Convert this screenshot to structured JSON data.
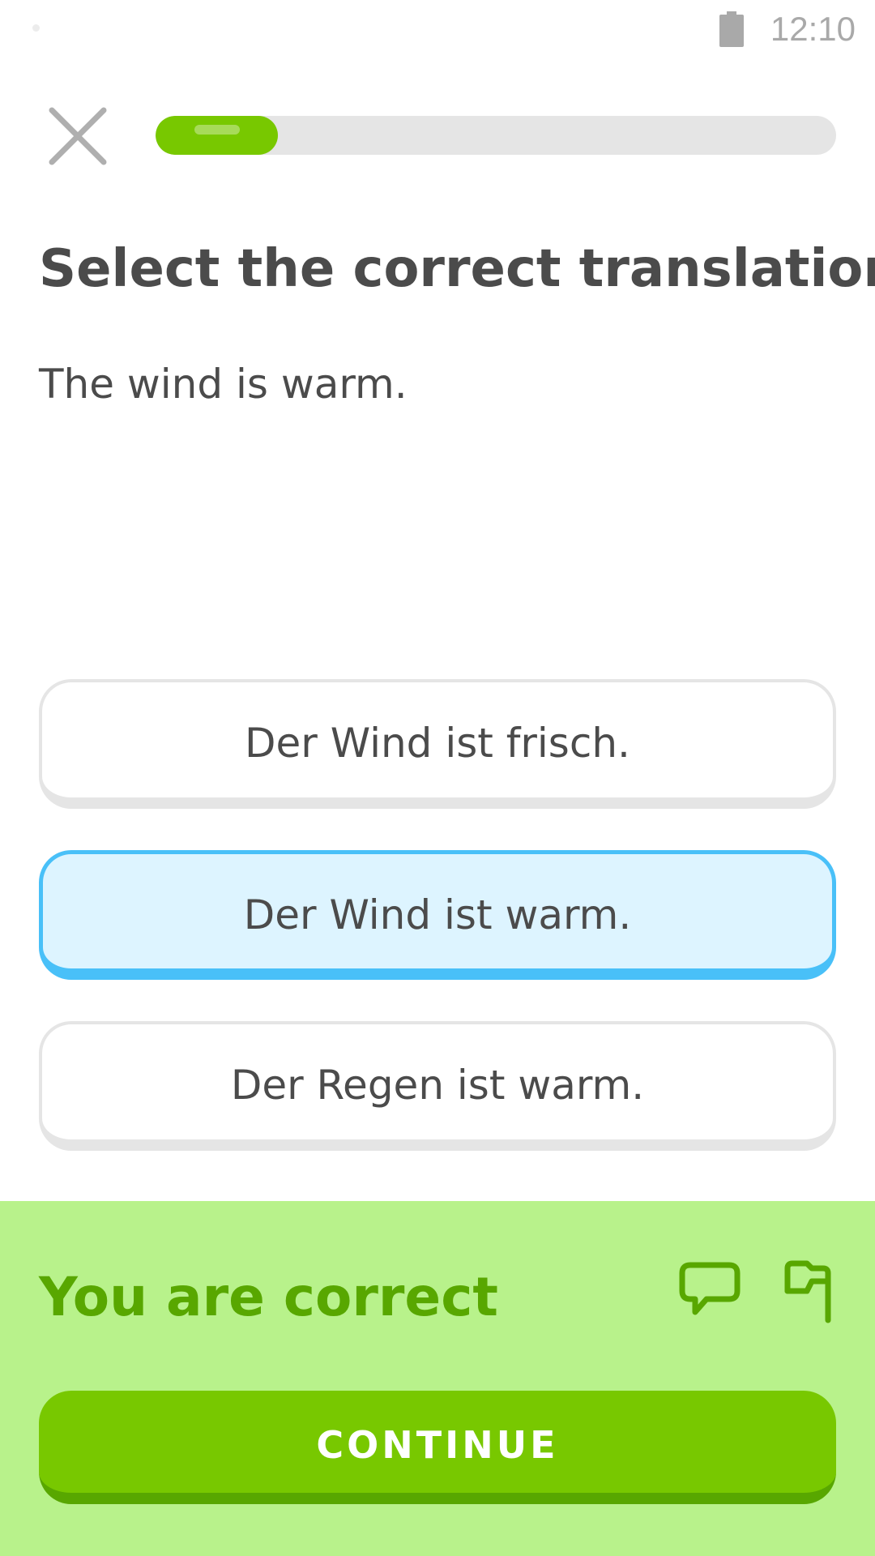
{
  "status_bar": {
    "time": "12:10"
  },
  "lesson": {
    "progress_fraction": 0.18
  },
  "instruction": "Select the correct translation",
  "prompt": "The wind is warm.",
  "choices": [
    {
      "label": "Der Wind ist frisch.",
      "selected": false
    },
    {
      "label": "Der Wind ist warm.",
      "selected": true
    },
    {
      "label": "Der Regen ist warm.",
      "selected": false
    }
  ],
  "feedback": {
    "title": "You are correct",
    "continue_label": "CONTINUE"
  },
  "colors": {
    "accent_green": "#78c800",
    "feedback_bg": "#b8f28b",
    "feedback_text": "#58a700",
    "selected_border": "#49c0f8",
    "selected_bg": "#ddf4ff"
  },
  "icons": {
    "close": "close-icon",
    "battery": "battery-icon",
    "discuss": "chat-bubble-icon",
    "report": "flag-icon"
  }
}
